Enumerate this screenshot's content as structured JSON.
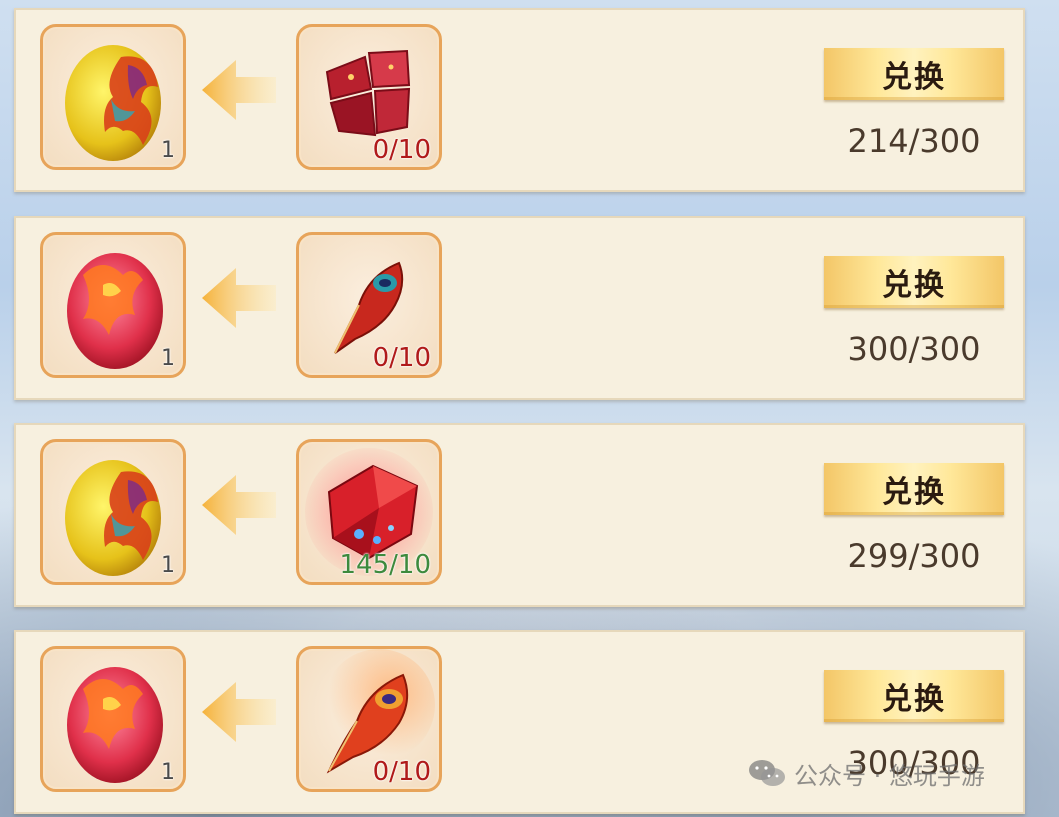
{
  "rows": [
    {
      "reward": {
        "icon": "golden-dragon-egg-icon",
        "count": "1"
      },
      "cost": {
        "icon": "red-gem-chunk-icon",
        "progress": "0/10",
        "status": "insufficient"
      },
      "button_label": "兑换",
      "limit": "214/300"
    },
    {
      "reward": {
        "icon": "red-phoenix-egg-icon",
        "count": "1"
      },
      "cost": {
        "icon": "phoenix-feather-icon",
        "progress": "0/10",
        "status": "insufficient"
      },
      "button_label": "兑换",
      "limit": "300/300"
    },
    {
      "reward": {
        "icon": "golden-dragon-egg-icon",
        "count": "1"
      },
      "cost": {
        "icon": "glowing-red-crystal-icon",
        "progress": "145/10",
        "status": "sufficient"
      },
      "button_label": "兑换",
      "limit": "299/300"
    },
    {
      "reward": {
        "icon": "red-phoenix-egg-icon",
        "count": "1"
      },
      "cost": {
        "icon": "flaming-feather-icon",
        "progress": "0/10",
        "status": "insufficient"
      },
      "button_label": "兑换",
      "limit": "300/300"
    }
  ],
  "colors": {
    "insufficient": "#b01a1a",
    "sufficient": "#3d8a3d",
    "slot_border": "#e7a45a"
  },
  "watermark": {
    "text": "公众号 · 悠玩手游",
    "icon": "wechat-icon"
  }
}
